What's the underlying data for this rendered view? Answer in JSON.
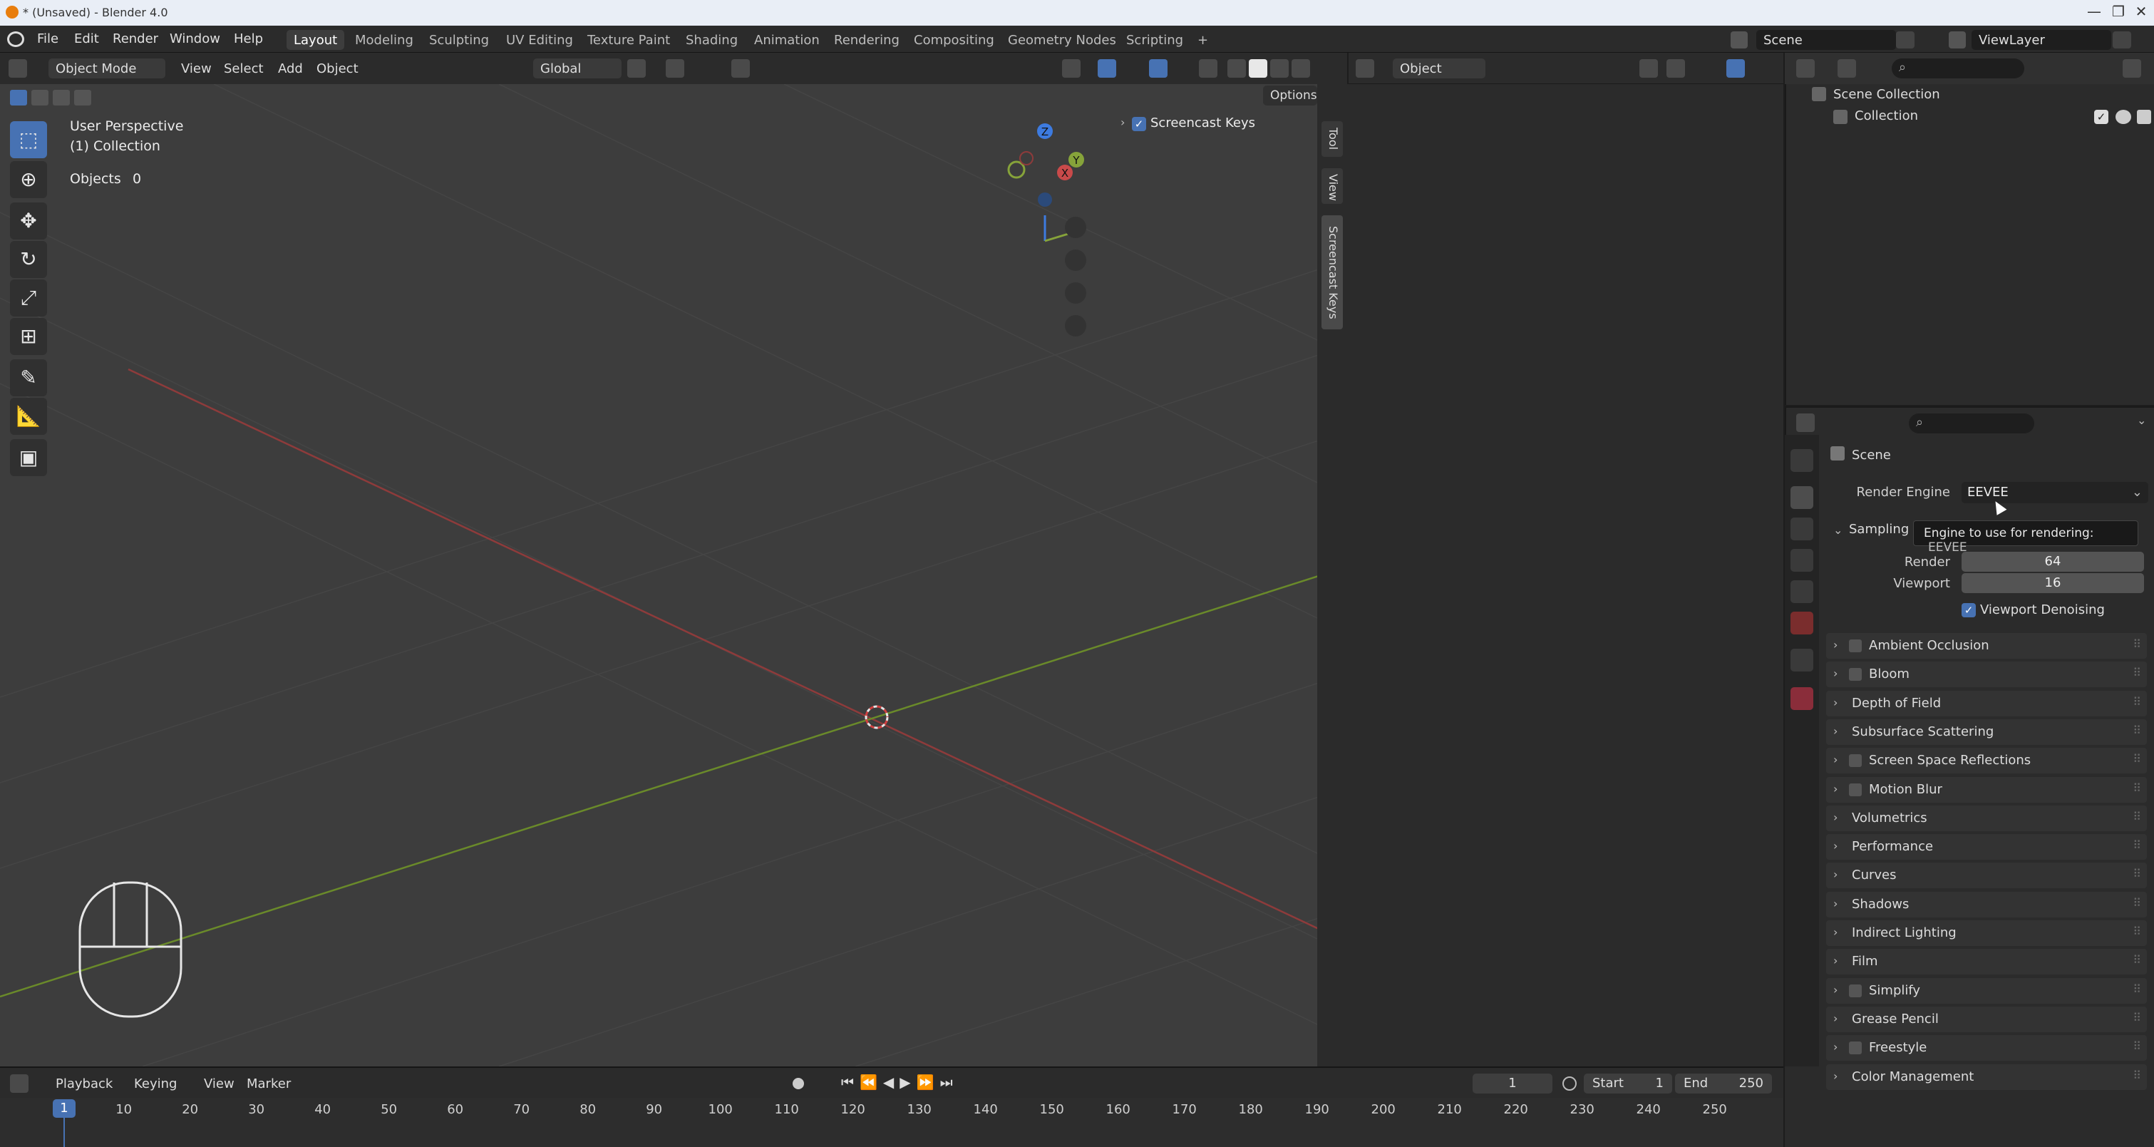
{
  "window": {
    "title": "* (Unsaved) - Blender 4.0",
    "controls": [
      "—",
      "❐",
      "✕"
    ]
  },
  "menu": {
    "items": [
      "File",
      "Edit",
      "Render",
      "Window",
      "Help"
    ],
    "workspaces": [
      "Layout",
      "Modeling",
      "Sculpting",
      "UV Editing",
      "Texture Paint",
      "Shading",
      "Animation",
      "Rendering",
      "Compositing",
      "Geometry Nodes",
      "Scripting"
    ],
    "active_workspace": "Layout",
    "add_tab": "+",
    "scene": "Scene",
    "view_layer": "ViewLayer"
  },
  "viewport_header": {
    "mode": "Object Mode",
    "menus": [
      "View",
      "Select",
      "Add",
      "Object"
    ],
    "orientation": "Global",
    "options": "Options"
  },
  "viewport": {
    "perspective": "User Perspective",
    "collection": "(1) Collection",
    "objects_label": "Objects",
    "objects_count": "0",
    "screencast_label": "Screencast Keys",
    "side_tabs": [
      "Tool",
      "View",
      "Screencast Keys"
    ],
    "gizmo_axes": {
      "z": "Z",
      "y": "Y",
      "x": "X"
    }
  },
  "mid_header": {
    "object_field": "Object"
  },
  "outliner": {
    "root": "Scene Collection",
    "children": [
      "Collection"
    ]
  },
  "properties": {
    "context": "Scene",
    "render_engine_label": "Render Engine",
    "render_engine_value": "EEVEE",
    "tooltip_text": "Engine to use for rendering:",
    "tooltip_value": "EEVEE",
    "sampling_label": "Sampling",
    "render_label": "Render",
    "render_value": "64",
    "viewport_label": "Viewport",
    "viewport_value": "16",
    "denoise_label": "Viewport Denoising",
    "panels": [
      {
        "label": "Ambient Occlusion",
        "checkbox": true
      },
      {
        "label": "Bloom",
        "checkbox": true
      },
      {
        "label": "Depth of Field",
        "checkbox": false
      },
      {
        "label": "Subsurface Scattering",
        "checkbox": false
      },
      {
        "label": "Screen Space Reflections",
        "checkbox": true
      },
      {
        "label": "Motion Blur",
        "checkbox": true
      },
      {
        "label": "Volumetrics",
        "checkbox": false
      },
      {
        "label": "Performance",
        "checkbox": false
      },
      {
        "label": "Curves",
        "checkbox": false
      },
      {
        "label": "Shadows",
        "checkbox": false
      },
      {
        "label": "Indirect Lighting",
        "checkbox": false
      },
      {
        "label": "Film",
        "checkbox": false
      },
      {
        "label": "Simplify",
        "checkbox": true
      },
      {
        "label": "Grease Pencil",
        "checkbox": false
      },
      {
        "label": "Freestyle",
        "checkbox": true
      },
      {
        "label": "Color Management",
        "checkbox": false
      }
    ]
  },
  "timeline": {
    "menus": [
      "Playback",
      "Keying",
      "View",
      "Marker"
    ],
    "current_frame": "1",
    "start_label": "Start",
    "start_value": "1",
    "end_label": "End",
    "end_value": "250",
    "ticks": [
      "1",
      "10",
      "20",
      "30",
      "40",
      "50",
      "60",
      "70",
      "80",
      "90",
      "100",
      "110",
      "120",
      "130",
      "140",
      "150",
      "160",
      "170",
      "180",
      "190",
      "200",
      "210",
      "220",
      "230",
      "240",
      "250"
    ]
  },
  "colors": {
    "accent": "#4772b3",
    "x_axis": "#c94a4a",
    "y_axis": "#86a33a",
    "z_axis": "#3d7be0"
  }
}
